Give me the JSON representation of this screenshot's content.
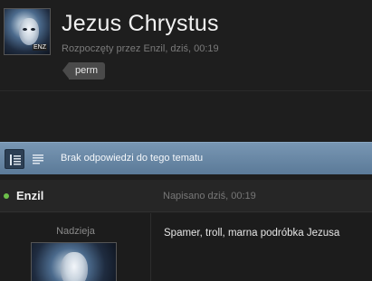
{
  "topic": {
    "title": "Jezus Chrystus",
    "meta": "Rozpoczęty przez Enzil, dziś, 00:19",
    "tag": "perm",
    "avatar_label": "Enzil"
  },
  "toolbar": {
    "message": "Brak odpowiedzi do tego tematu",
    "view_icons": [
      "list-view-icon",
      "text-view-icon"
    ]
  },
  "post": {
    "author": "Enzil",
    "status_color": "#6cc04a",
    "date": "Napisano dziś, 00:19",
    "author_rank": "Nadzieja",
    "content": "Spamer, troll, marna podróbka Jezusa"
  },
  "colors": {
    "background": "#1e1e1e",
    "toolbar_top": "#7896b3",
    "toolbar_bottom": "#5b7a98",
    "tag_bg": "#4a4a4a"
  }
}
